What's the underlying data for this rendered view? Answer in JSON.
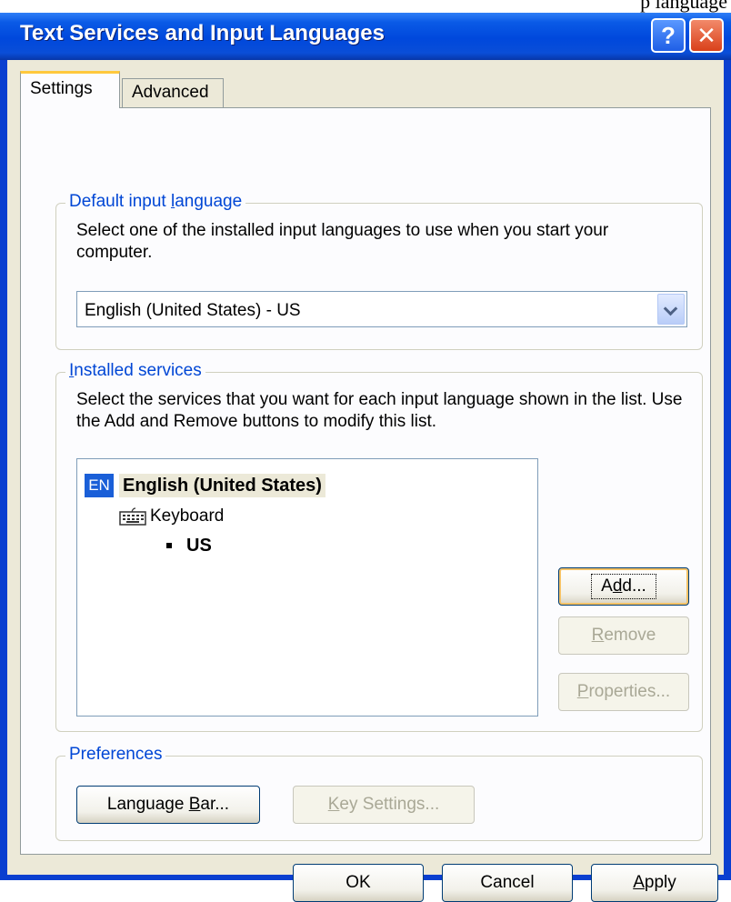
{
  "top_overflow_text": "p language",
  "window": {
    "title": "Text Services and Input Languages",
    "help_glyph": "?",
    "close_glyph": "✕"
  },
  "tabs": [
    {
      "label": "Settings",
      "active": true
    },
    {
      "label": "Advanced",
      "active": false
    }
  ],
  "default_input": {
    "legend_pre": "Default input ",
    "legend_key": "l",
    "legend_post": "anguage",
    "description": "Select one of the installed input languages to use when you start your computer.",
    "selected_value": "English (United States) - US"
  },
  "installed_services": {
    "legend_key": "I",
    "legend_post": "nstalled services",
    "description": "Select the services that you want for each input language shown in the list. Use the Add and Remove buttons to modify this list.",
    "language_badge": "EN",
    "language_name": "English (United States)",
    "keyboard_label": "Keyboard",
    "layout_label": "US",
    "buttons": {
      "add_pre": "A",
      "add_key": "d",
      "add_post": "d...",
      "remove_key": "R",
      "remove_post": "emove",
      "properties_key": "P",
      "properties_post": "roperties..."
    }
  },
  "preferences": {
    "legend": "Preferences",
    "language_bar_pre": "Language ",
    "language_bar_key": "B",
    "language_bar_post": "ar...",
    "key_settings_key": "K",
    "key_settings_post": "ey Settings..."
  },
  "footer": {
    "ok": "OK",
    "cancel": "Cancel",
    "apply_key": "A",
    "apply_post": "pply"
  },
  "colors": {
    "titlebar": "#0a4ed8",
    "dialog_bg": "#ece9d8",
    "group_legend": "#0046d5",
    "active_tab_accent": "#ffc83c"
  }
}
